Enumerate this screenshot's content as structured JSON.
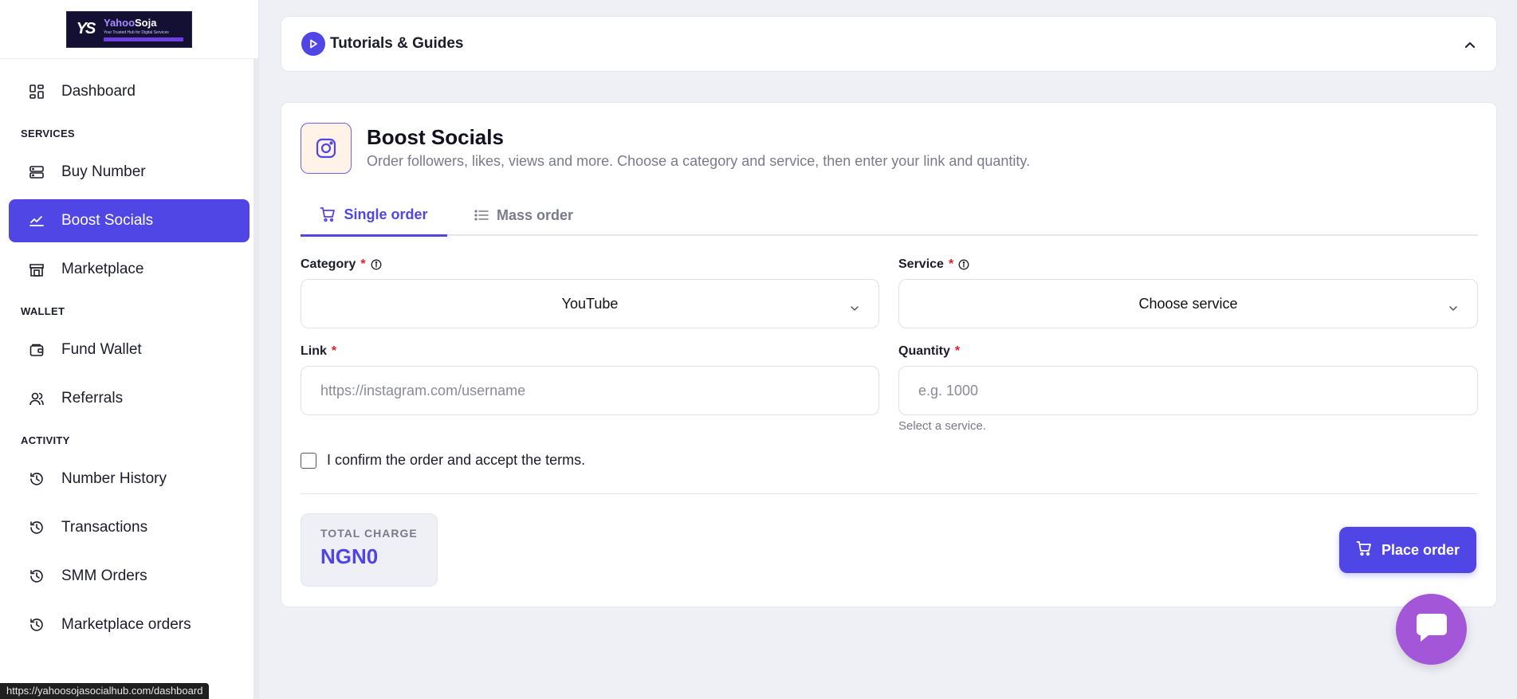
{
  "logo": {
    "mark": "YS",
    "brand_a": "Yahoo",
    "brand_b": "Soja",
    "tagline": "Your Trusted Hub for Digital Services"
  },
  "sidebar": {
    "dashboard": "Dashboard",
    "sections": {
      "services": "SERVICES",
      "wallet": "WALLET",
      "activity": "ACTIVITY"
    },
    "items": {
      "buy_number": "Buy Number",
      "boost_socials": "Boost Socials",
      "marketplace": "Marketplace",
      "fund_wallet": "Fund Wallet",
      "referrals": "Referrals",
      "number_history": "Number History",
      "transactions": "Transactions",
      "smm_orders": "SMM Orders",
      "marketplace_orders": "Marketplace orders"
    },
    "active": "boost_socials"
  },
  "status_url": "https://yahoosojasocialhub.com/dashboard",
  "tutorials": {
    "title": "Tutorials & Guides",
    "expanded": true
  },
  "page": {
    "title": "Boost Socials",
    "subtitle": "Order followers, likes, views and more. Choose a category and service, then enter your link and quantity."
  },
  "tabs": {
    "single": "Single order",
    "mass": "Mass order",
    "active": "single"
  },
  "form": {
    "category": {
      "label": "Category",
      "value": "YouTube"
    },
    "service": {
      "label": "Service",
      "value": "Choose service"
    },
    "link": {
      "label": "Link",
      "placeholder": "https://instagram.com/username",
      "value": ""
    },
    "quantity": {
      "label": "Quantity",
      "placeholder": "e.g. 1000",
      "value": "",
      "hint": "Select a service."
    },
    "required_mark": "*",
    "confirm_label": "I confirm the order and accept the terms.",
    "confirm_checked": false
  },
  "total": {
    "label": "TOTAL CHARGE",
    "amount": "NGN0"
  },
  "place_order": "Place order",
  "colors": {
    "accent": "#4f46e5",
    "chat": "#a356d8",
    "required": "#e11d2b"
  }
}
